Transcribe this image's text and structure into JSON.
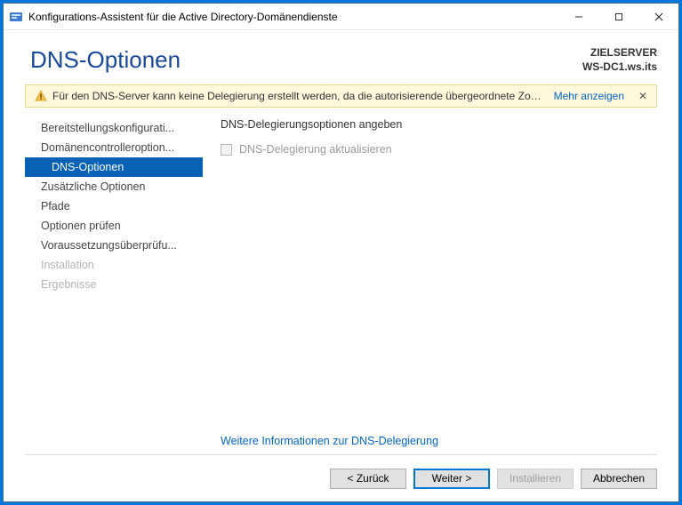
{
  "window": {
    "title": "Konfigurations-Assistent für die Active Directory-Domänendienste"
  },
  "header": {
    "page_title": "DNS-Optionen",
    "target_label": "ZIELSERVER",
    "target_name": "WS-DC1.ws.its"
  },
  "warning": {
    "text": "Für den DNS-Server kann keine Delegierung erstellt werden, da die autorisierende übergeordnete Zone...",
    "show_more": "Mehr anzeigen",
    "close": "✕"
  },
  "sidebar": {
    "items": [
      {
        "label": "Bereitstellungskonfigurati..."
      },
      {
        "label": "Domänencontrolleroption..."
      },
      {
        "label": "DNS-Optionen"
      },
      {
        "label": "Zusätzliche Optionen"
      },
      {
        "label": "Pfade"
      },
      {
        "label": "Optionen prüfen"
      },
      {
        "label": "Voraussetzungsüberprüfu..."
      },
      {
        "label": "Installation"
      },
      {
        "label": "Ergebnisse"
      }
    ]
  },
  "content": {
    "heading": "DNS-Delegierungsoptionen angeben",
    "checkbox_label": "DNS-Delegierung aktualisieren",
    "info_link": "Weitere Informationen zur DNS-Delegierung"
  },
  "footer": {
    "back": "< Zurück",
    "next": "Weiter >",
    "install": "Installieren",
    "cancel": "Abbrechen"
  }
}
